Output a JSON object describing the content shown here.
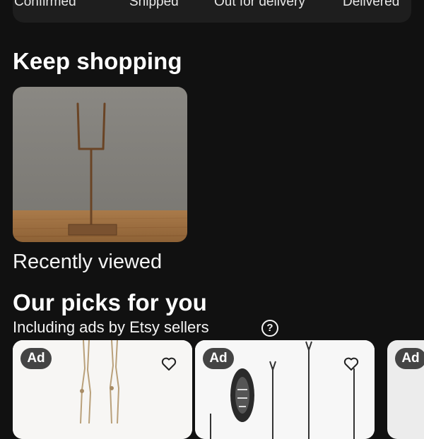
{
  "order_status": {
    "steps": [
      "Confirmed",
      "Shipped",
      "Out for delivery",
      "Delivered"
    ]
  },
  "keep_shopping": {
    "title": "Keep shopping",
    "recent_label": "Recently viewed"
  },
  "picks": {
    "title": "Our picks for you",
    "subtitle": "Including ads by Etsy sellers",
    "help_icon_char": "?",
    "cards": [
      {
        "badge": "Ad",
        "icon": "heart-icon"
      },
      {
        "badge": "Ad",
        "icon": "heart-icon"
      },
      {
        "badge": "Ad"
      }
    ]
  },
  "colors": {
    "background": "#111111",
    "card_surface": "#1e1e1e",
    "text": "#ffffff",
    "badge_bg": "#444444"
  }
}
